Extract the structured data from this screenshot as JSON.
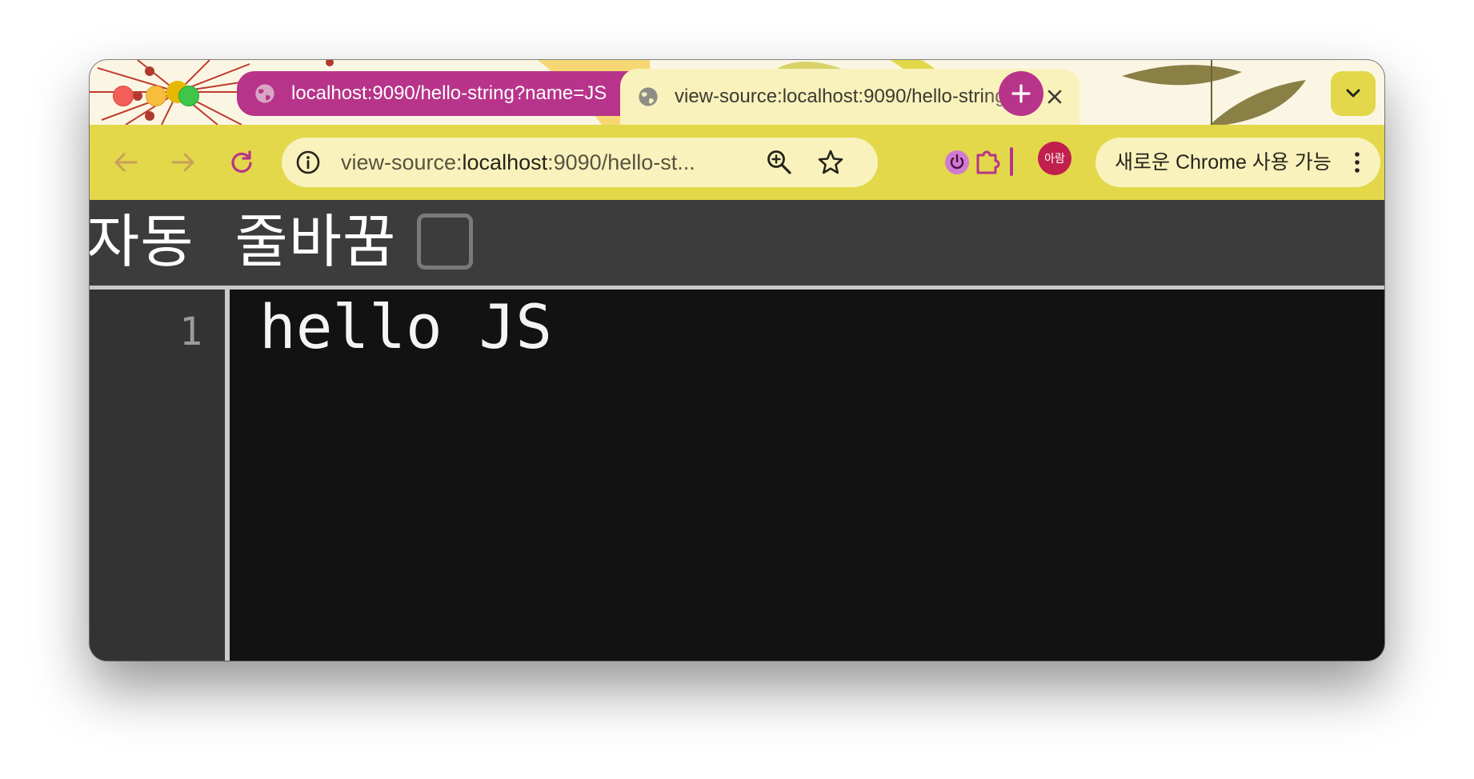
{
  "browser": {
    "tabs": [
      {
        "title": "localhost:9090/hello-string?name=JS",
        "active": false
      },
      {
        "title": "view-source:localhost:9090/hello-string?name=JS",
        "active": true
      }
    ],
    "address_bar": {
      "scheme_prefix": "view-source:",
      "host": "localhost",
      "rest": ":9090/hello-st..."
    },
    "profile_avatar_label": "아람",
    "update_button_label": "새로운 Chrome 사용 가능",
    "theme": {
      "tab_accent": "#b8348a",
      "toolbar": "#e2d84a",
      "omnibox": "#f9f2bd"
    }
  },
  "view_source": {
    "line_wrap_label": "자동 줄바꿈",
    "line_wrap_checked": false,
    "lines": [
      {
        "number": "1",
        "content": "hello JS"
      }
    ]
  }
}
